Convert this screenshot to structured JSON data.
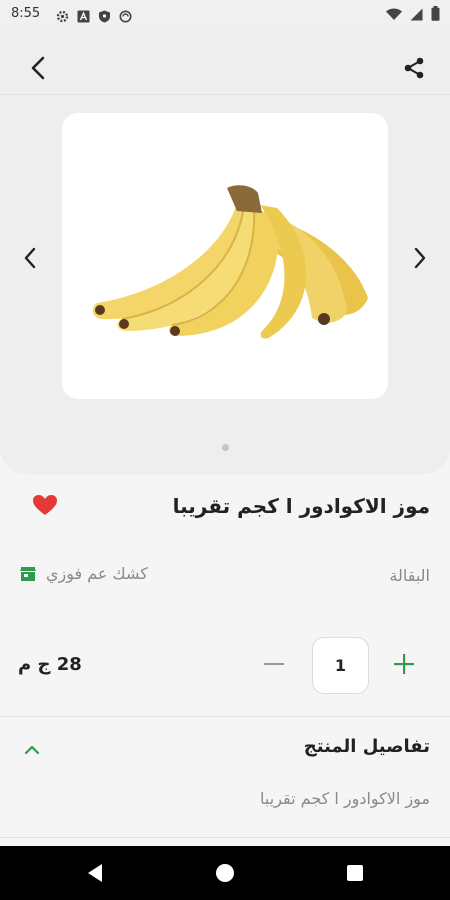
{
  "status_bar": {
    "time": "8:55"
  },
  "product": {
    "title": "موز الاكوادور ا كجم تقريبا",
    "price": "28 ج م",
    "quantity": "1",
    "image_icon": "banana-image"
  },
  "seller": {
    "section_label": "البقالة",
    "store_name": "كشك عم فوزي"
  },
  "details": {
    "header": "تفاصيل المنتج",
    "text": "موز الاكوادور ا كجم تقريبا"
  },
  "colors": {
    "accent_green": "#2e9c4b",
    "heart_red": "#e53935",
    "card_bg": "#eeeeee"
  }
}
